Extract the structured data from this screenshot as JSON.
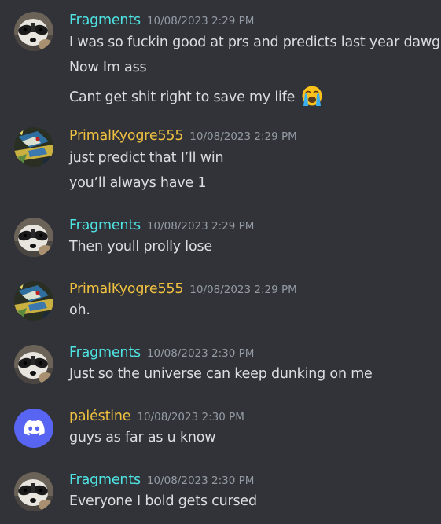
{
  "colors": {
    "fragments": "#4fe4e4",
    "primal": "#f0c040",
    "palestine": "#f0c040",
    "background": "#313338",
    "timestamp": "#949ba4",
    "text": "#dbdee1",
    "discord_blurple": "#5865f2"
  },
  "messages": [
    {
      "author": "Fragments",
      "timestamp": "10/08/2023 2:29 PM",
      "avatar": "raccoon-avatar",
      "lines": [
        "I was so fuckin good at prs and predicts last year dawg",
        "Now Im ass",
        "Cant get shit right to save my life"
      ],
      "emoji": "loudly-crying-face-emoji"
    },
    {
      "author": "PrimalKyogre555",
      "timestamp": "10/08/2023 2:29 PM",
      "avatar": "kyogre-avatar",
      "lines": [
        "just predict that I’ll win",
        "you’ll always have 1"
      ]
    },
    {
      "author": "Fragments",
      "timestamp": "10/08/2023 2:29 PM",
      "avatar": "raccoon-avatar",
      "lines": [
        "Then youll prolly lose"
      ]
    },
    {
      "author": "PrimalKyogre555",
      "timestamp": "10/08/2023 2:29 PM",
      "avatar": "kyogre-avatar",
      "lines": [
        "oh."
      ]
    },
    {
      "author": "Fragments",
      "timestamp": "10/08/2023 2:30 PM",
      "avatar": "raccoon-avatar",
      "lines": [
        "Just so the universe can keep dunking on me"
      ]
    },
    {
      "author": "paléstine",
      "timestamp": "10/08/2023 2:30 PM",
      "avatar": "discord-default-avatar",
      "lines": [
        "guys as far as u know"
      ]
    },
    {
      "author": "Fragments",
      "timestamp": "10/08/2023 2:30 PM",
      "avatar": "raccoon-avatar",
      "lines": [
        "Everyone I bold gets cursed"
      ]
    }
  ]
}
